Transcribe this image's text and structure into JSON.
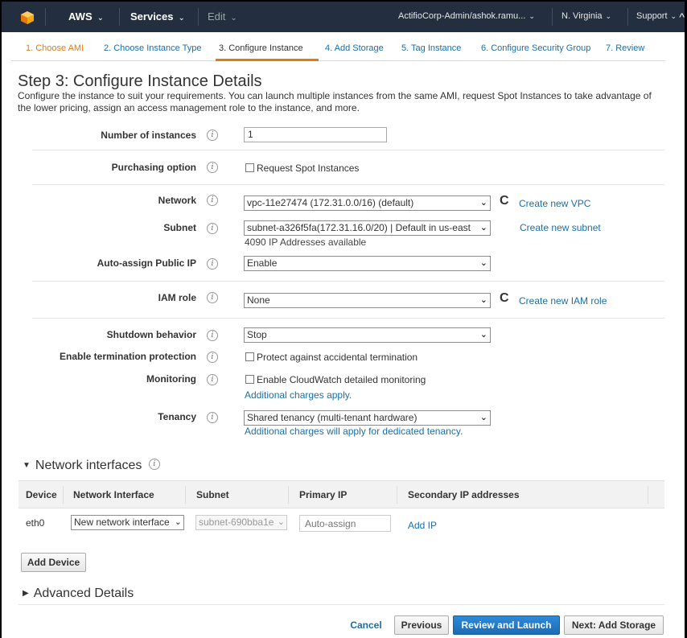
{
  "topbar": {
    "brand": "AWS",
    "services": "Services",
    "edit": "Edit",
    "account": "ActifioCorp-Admin/ashok.ramu...",
    "region": "N. Virginia",
    "support": "Support",
    "caret": "⌄",
    "chevron_up": "^"
  },
  "wizard": {
    "steps": [
      {
        "label": "1. Choose AMI",
        "state": "done"
      },
      {
        "label": "2. Choose Instance Type",
        "state": "link"
      },
      {
        "label": "3. Configure Instance",
        "state": "active"
      },
      {
        "label": "4. Add Storage",
        "state": "link"
      },
      {
        "label": "5. Tag Instance",
        "state": "link"
      },
      {
        "label": "6. Configure Security Group",
        "state": "link"
      },
      {
        "label": "7. Review",
        "state": "link"
      }
    ]
  },
  "page": {
    "title": "Step 3: Configure Instance Details",
    "description": "Configure the instance to suit your requirements. You can launch multiple instances from the same AMI, request Spot Instances to take advantage of the lower pricing, assign an access management role to the instance, and more."
  },
  "form": {
    "info_glyph": "i",
    "instances": {
      "label": "Number of instances",
      "value": "1"
    },
    "purchasing": {
      "label": "Purchasing option",
      "checkbox": "Request Spot Instances"
    },
    "network": {
      "label": "Network",
      "value": "vpc-11e27474 (172.31.0.0/16) (default)",
      "link": "Create new VPC"
    },
    "subnet": {
      "label": "Subnet",
      "value": "subnet-a326f5fa(172.31.16.0/20) | Default in us-east",
      "hint": "4090 IP Addresses available",
      "link": "Create new subnet"
    },
    "public_ip": {
      "label": "Auto-assign Public IP",
      "value": "Enable"
    },
    "iam": {
      "label": "IAM role",
      "value": "None",
      "link": "Create new IAM role"
    },
    "shutdown": {
      "label": "Shutdown behavior",
      "value": "Stop"
    },
    "termination": {
      "label": "Enable termination protection",
      "checkbox": "Protect against accidental termination"
    },
    "monitoring": {
      "label": "Monitoring",
      "checkbox": "Enable CloudWatch detailed monitoring",
      "note": "Additional charges apply."
    },
    "tenancy": {
      "label": "Tenancy",
      "value": "Shared tenancy (multi-tenant hardware)",
      "note": "Additional charges will apply for dedicated tenancy."
    },
    "refresh_icon": "C",
    "dropdown_arrow": "⌄"
  },
  "network_interfaces": {
    "title": "Network interfaces",
    "toggle": "▼",
    "info_glyph": "i",
    "columns": [
      "Device",
      "Network Interface",
      "Subnet",
      "Primary IP",
      "Secondary IP addresses"
    ],
    "row": {
      "device": "eth0",
      "interface": "New network interface",
      "subnet": "subnet-690bba1e",
      "primary_ip_placeholder": "Auto-assign",
      "add_ip": "Add IP"
    },
    "add_device": "Add Device"
  },
  "advanced": {
    "toggle": "▶",
    "title": "Advanced Details"
  },
  "footer": {
    "cancel": "Cancel",
    "previous": "Previous",
    "review": "Review and Launch",
    "next": "Next: Add Storage"
  },
  "colors": {
    "aws_orange": "#e47911",
    "link_blue": "#1a6fa8",
    "header_bg": "#232f3e",
    "primary_button": "#1b6cb4"
  }
}
